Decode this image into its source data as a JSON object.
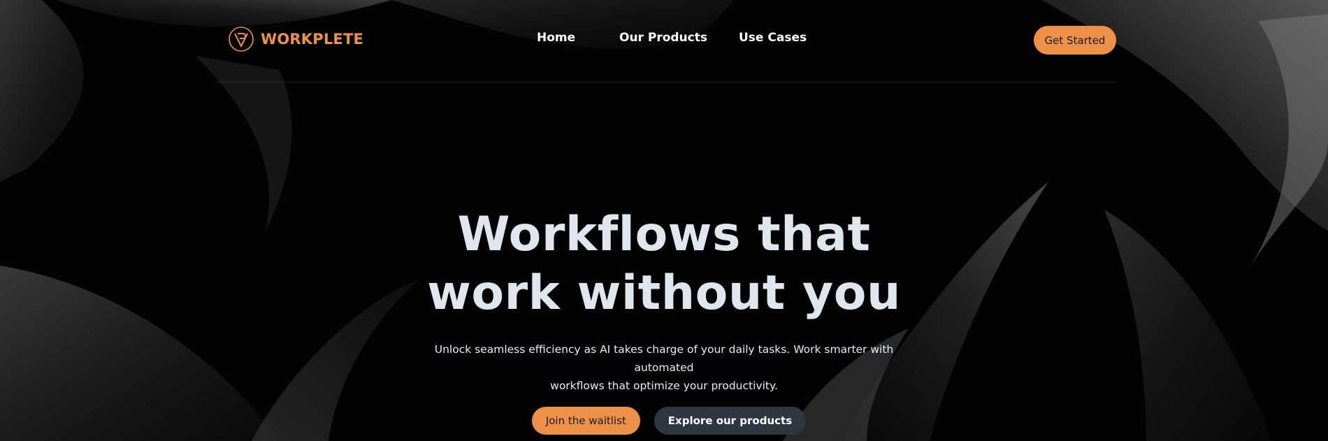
{
  "brand": {
    "name": "WORKPLETE",
    "accent_color": "#ee9148",
    "logo_icon": "workplete-logo-icon"
  },
  "nav": {
    "links": [
      "Home",
      "Our Products",
      "Use Cases"
    ],
    "cta_label": "Get Started"
  },
  "hero": {
    "title_line1": "Workflows that",
    "title_line2": "work without you",
    "subtitle_line1": "Unlock seamless efficiency as AI takes charge of your daily tasks. Work smarter with automated",
    "subtitle_line2": "workflows that optimize your productivity.",
    "primary_cta": "Join the waitlist",
    "secondary_cta": "Explore our products"
  },
  "colors": {
    "background": "#000000",
    "title": "#dfe6ee",
    "secondary_button": "#2e3640"
  }
}
